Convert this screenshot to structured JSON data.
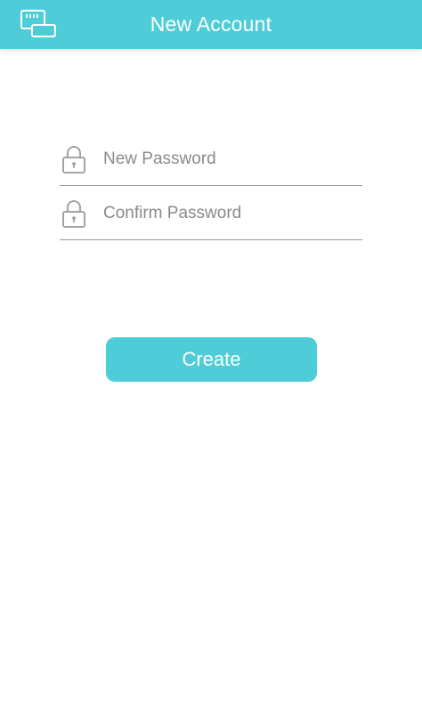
{
  "header": {
    "title": "New Account",
    "icon": "router-network-icon"
  },
  "form": {
    "new_password": {
      "placeholder": "New Password",
      "value": "",
      "icon": "lock-icon"
    },
    "confirm_password": {
      "placeholder": "Confirm Password",
      "value": "",
      "icon": "lock-icon"
    }
  },
  "actions": {
    "create_label": "Create"
  },
  "colors": {
    "accent": "#4ecdd8",
    "divider": "#9a9a9a",
    "placeholder": "#8a8a8a",
    "icon_stroke": "#9a9a9a"
  }
}
